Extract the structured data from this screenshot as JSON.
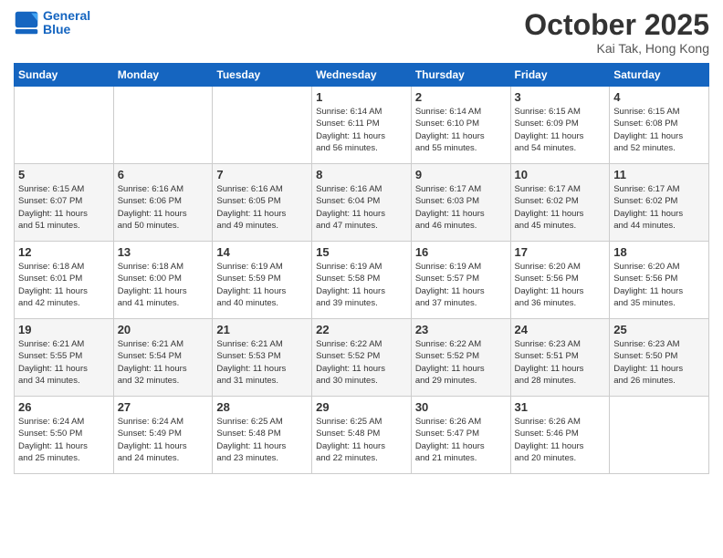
{
  "header": {
    "logo_line1": "General",
    "logo_line2": "Blue",
    "month_title": "October 2025",
    "location": "Kai Tak, Hong Kong"
  },
  "weekdays": [
    "Sunday",
    "Monday",
    "Tuesday",
    "Wednesday",
    "Thursday",
    "Friday",
    "Saturday"
  ],
  "weeks": [
    [
      {
        "day": "",
        "sunrise": "",
        "sunset": "",
        "daylight": ""
      },
      {
        "day": "",
        "sunrise": "",
        "sunset": "",
        "daylight": ""
      },
      {
        "day": "",
        "sunrise": "",
        "sunset": "",
        "daylight": ""
      },
      {
        "day": "1",
        "sunrise": "Sunrise: 6:14 AM",
        "sunset": "Sunset: 6:11 PM",
        "daylight": "Daylight: 11 hours and 56 minutes."
      },
      {
        "day": "2",
        "sunrise": "Sunrise: 6:14 AM",
        "sunset": "Sunset: 6:10 PM",
        "daylight": "Daylight: 11 hours and 55 minutes."
      },
      {
        "day": "3",
        "sunrise": "Sunrise: 6:15 AM",
        "sunset": "Sunset: 6:09 PM",
        "daylight": "Daylight: 11 hours and 54 minutes."
      },
      {
        "day": "4",
        "sunrise": "Sunrise: 6:15 AM",
        "sunset": "Sunset: 6:08 PM",
        "daylight": "Daylight: 11 hours and 52 minutes."
      }
    ],
    [
      {
        "day": "5",
        "sunrise": "Sunrise: 6:15 AM",
        "sunset": "Sunset: 6:07 PM",
        "daylight": "Daylight: 11 hours and 51 minutes."
      },
      {
        "day": "6",
        "sunrise": "Sunrise: 6:16 AM",
        "sunset": "Sunset: 6:06 PM",
        "daylight": "Daylight: 11 hours and 50 minutes."
      },
      {
        "day": "7",
        "sunrise": "Sunrise: 6:16 AM",
        "sunset": "Sunset: 6:05 PM",
        "daylight": "Daylight: 11 hours and 49 minutes."
      },
      {
        "day": "8",
        "sunrise": "Sunrise: 6:16 AM",
        "sunset": "Sunset: 6:04 PM",
        "daylight": "Daylight: 11 hours and 47 minutes."
      },
      {
        "day": "9",
        "sunrise": "Sunrise: 6:17 AM",
        "sunset": "Sunset: 6:03 PM",
        "daylight": "Daylight: 11 hours and 46 minutes."
      },
      {
        "day": "10",
        "sunrise": "Sunrise: 6:17 AM",
        "sunset": "Sunset: 6:02 PM",
        "daylight": "Daylight: 11 hours and 45 minutes."
      },
      {
        "day": "11",
        "sunrise": "Sunrise: 6:17 AM",
        "sunset": "Sunset: 6:02 PM",
        "daylight": "Daylight: 11 hours and 44 minutes."
      }
    ],
    [
      {
        "day": "12",
        "sunrise": "Sunrise: 6:18 AM",
        "sunset": "Sunset: 6:01 PM",
        "daylight": "Daylight: 11 hours and 42 minutes."
      },
      {
        "day": "13",
        "sunrise": "Sunrise: 6:18 AM",
        "sunset": "Sunset: 6:00 PM",
        "daylight": "Daylight: 11 hours and 41 minutes."
      },
      {
        "day": "14",
        "sunrise": "Sunrise: 6:19 AM",
        "sunset": "Sunset: 5:59 PM",
        "daylight": "Daylight: 11 hours and 40 minutes."
      },
      {
        "day": "15",
        "sunrise": "Sunrise: 6:19 AM",
        "sunset": "Sunset: 5:58 PM",
        "daylight": "Daylight: 11 hours and 39 minutes."
      },
      {
        "day": "16",
        "sunrise": "Sunrise: 6:19 AM",
        "sunset": "Sunset: 5:57 PM",
        "daylight": "Daylight: 11 hours and 37 minutes."
      },
      {
        "day": "17",
        "sunrise": "Sunrise: 6:20 AM",
        "sunset": "Sunset: 5:56 PM",
        "daylight": "Daylight: 11 hours and 36 minutes."
      },
      {
        "day": "18",
        "sunrise": "Sunrise: 6:20 AM",
        "sunset": "Sunset: 5:56 PM",
        "daylight": "Daylight: 11 hours and 35 minutes."
      }
    ],
    [
      {
        "day": "19",
        "sunrise": "Sunrise: 6:21 AM",
        "sunset": "Sunset: 5:55 PM",
        "daylight": "Daylight: 11 hours and 34 minutes."
      },
      {
        "day": "20",
        "sunrise": "Sunrise: 6:21 AM",
        "sunset": "Sunset: 5:54 PM",
        "daylight": "Daylight: 11 hours and 32 minutes."
      },
      {
        "day": "21",
        "sunrise": "Sunrise: 6:21 AM",
        "sunset": "Sunset: 5:53 PM",
        "daylight": "Daylight: 11 hours and 31 minutes."
      },
      {
        "day": "22",
        "sunrise": "Sunrise: 6:22 AM",
        "sunset": "Sunset: 5:52 PM",
        "daylight": "Daylight: 11 hours and 30 minutes."
      },
      {
        "day": "23",
        "sunrise": "Sunrise: 6:22 AM",
        "sunset": "Sunset: 5:52 PM",
        "daylight": "Daylight: 11 hours and 29 minutes."
      },
      {
        "day": "24",
        "sunrise": "Sunrise: 6:23 AM",
        "sunset": "Sunset: 5:51 PM",
        "daylight": "Daylight: 11 hours and 28 minutes."
      },
      {
        "day": "25",
        "sunrise": "Sunrise: 6:23 AM",
        "sunset": "Sunset: 5:50 PM",
        "daylight": "Daylight: 11 hours and 26 minutes."
      }
    ],
    [
      {
        "day": "26",
        "sunrise": "Sunrise: 6:24 AM",
        "sunset": "Sunset: 5:50 PM",
        "daylight": "Daylight: 11 hours and 25 minutes."
      },
      {
        "day": "27",
        "sunrise": "Sunrise: 6:24 AM",
        "sunset": "Sunset: 5:49 PM",
        "daylight": "Daylight: 11 hours and 24 minutes."
      },
      {
        "day": "28",
        "sunrise": "Sunrise: 6:25 AM",
        "sunset": "Sunset: 5:48 PM",
        "daylight": "Daylight: 11 hours and 23 minutes."
      },
      {
        "day": "29",
        "sunrise": "Sunrise: 6:25 AM",
        "sunset": "Sunset: 5:48 PM",
        "daylight": "Daylight: 11 hours and 22 minutes."
      },
      {
        "day": "30",
        "sunrise": "Sunrise: 6:26 AM",
        "sunset": "Sunset: 5:47 PM",
        "daylight": "Daylight: 11 hours and 21 minutes."
      },
      {
        "day": "31",
        "sunrise": "Sunrise: 6:26 AM",
        "sunset": "Sunset: 5:46 PM",
        "daylight": "Daylight: 11 hours and 20 minutes."
      },
      {
        "day": "",
        "sunrise": "",
        "sunset": "",
        "daylight": ""
      }
    ]
  ]
}
